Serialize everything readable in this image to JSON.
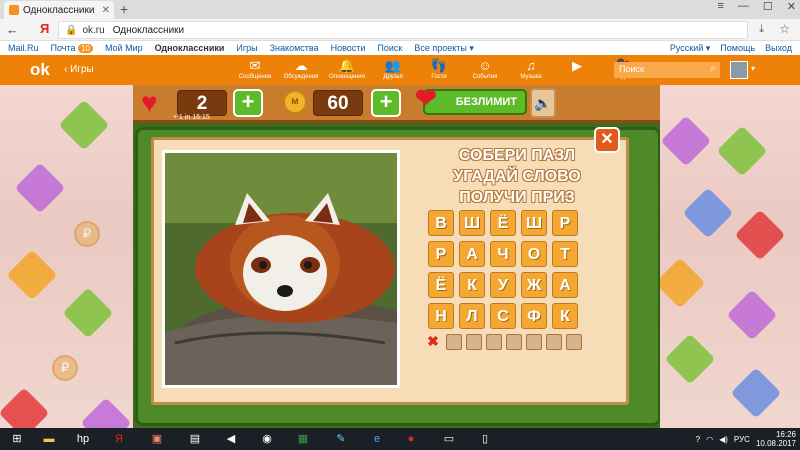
{
  "browser": {
    "tab_title": "Одноклассники",
    "new_tab": "+",
    "address_host": "ok.ru",
    "address_title": "Одноклассники"
  },
  "portal": {
    "mailru": "Mail.Ru",
    "mail": "Почта",
    "mail_count": "10",
    "my_world": "Мой Мир",
    "ok": "Одноклассники",
    "games": "Игры",
    "dating": "Знакомства",
    "news": "Новости",
    "search": "Поиск",
    "all_projects": "Все проекты",
    "language": "Русский",
    "help": "Помощь",
    "logout": "Выход"
  },
  "ok": {
    "back_label": "Игры",
    "nav": [
      {
        "icon": "messages-icon",
        "label": "Сообщения"
      },
      {
        "icon": "discussions-icon",
        "label": "Обсуждения"
      },
      {
        "icon": "notifications-icon",
        "label": "Оповещения"
      },
      {
        "icon": "friends-icon",
        "label": "Друзья"
      },
      {
        "icon": "guests-icon",
        "label": "Гости"
      },
      {
        "icon": "events-icon",
        "label": "События"
      },
      {
        "icon": "music-icon",
        "label": "Музыка"
      },
      {
        "icon": "video-icon",
        "label": "Видео"
      }
    ],
    "search_placeholder": "Поиск"
  },
  "game": {
    "lives": "2",
    "timer": "+ 1 in 16:15",
    "coins": "60",
    "unlimited": "БЕЗЛИМИТ",
    "slogan": [
      "СОБЕРИ ПАЗЛ",
      "УГАДАЙ СЛОВО",
      "ПОЛУЧИ ПРИЗ"
    ],
    "tiles": [
      [
        "В",
        "Ш",
        "Ё",
        "Ш",
        "Р"
      ],
      [
        "Р",
        "А",
        "Ч",
        "О",
        "Т"
      ],
      [
        "Ё",
        "К",
        "У",
        "Ж",
        "А"
      ],
      [
        "Н",
        "Л",
        "С",
        "Ф",
        "К"
      ]
    ],
    "answer_slots": 7,
    "colors": {
      "tile": "#f4a733",
      "heart": "#e4192a",
      "green": "#5dbb2a",
      "orange_bar": "#ee8208"
    }
  },
  "taskbar": {
    "lang": "РУС",
    "time": "16:26",
    "date": "10.08.2017"
  }
}
